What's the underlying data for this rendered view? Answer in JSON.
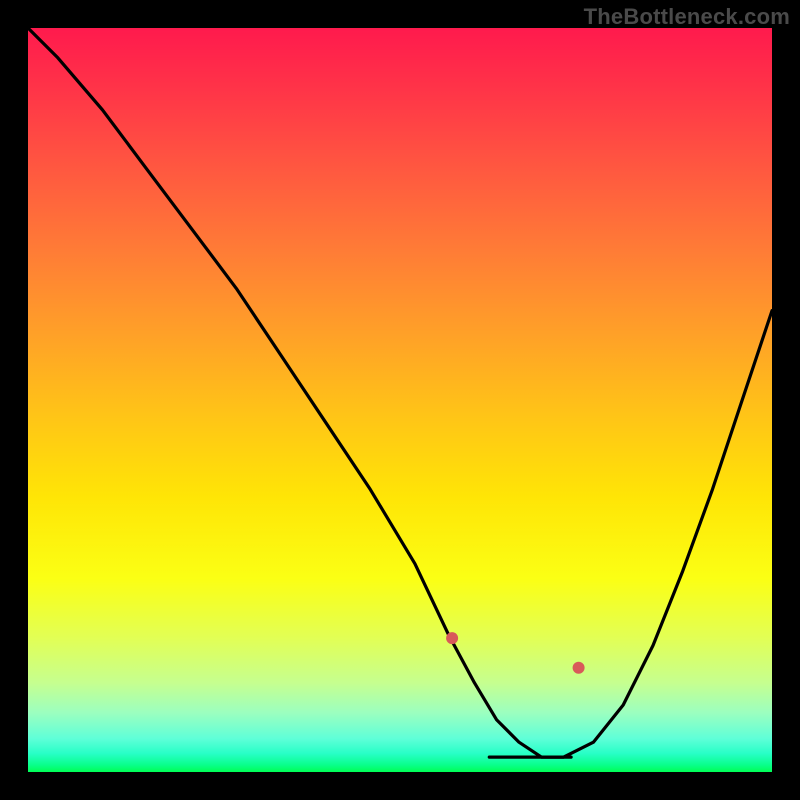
{
  "attribution": "TheBottleneck.com",
  "chart_data": {
    "type": "line",
    "title": "",
    "xlabel": "",
    "ylabel": "",
    "x_range": [
      0,
      100
    ],
    "y_range": [
      0,
      100
    ],
    "series": [
      {
        "name": "bottleneck-curve",
        "x": [
          0,
          4,
          10,
          16,
          22,
          28,
          34,
          40,
          46,
          52,
          56.5,
          60,
          63,
          66,
          69,
          72,
          76,
          80,
          84,
          88,
          92,
          96,
          100
        ],
        "y": [
          100,
          96,
          89,
          81,
          73,
          65,
          56,
          47,
          38,
          28,
          18.5,
          12,
          7,
          4,
          2,
          2,
          4,
          9,
          17,
          27,
          38,
          50,
          62
        ]
      }
    ],
    "optimal_plateau": {
      "x_start": 62,
      "x_end": 73,
      "y": 2
    },
    "markers": [
      {
        "name": "left-marker",
        "x": 57,
        "y": 18
      },
      {
        "name": "right-marker",
        "x": 74,
        "y": 14
      }
    ],
    "background_gradient": {
      "top": "#ff1a4d",
      "mid": "#ffe506",
      "bottom": "#00ff55"
    }
  }
}
